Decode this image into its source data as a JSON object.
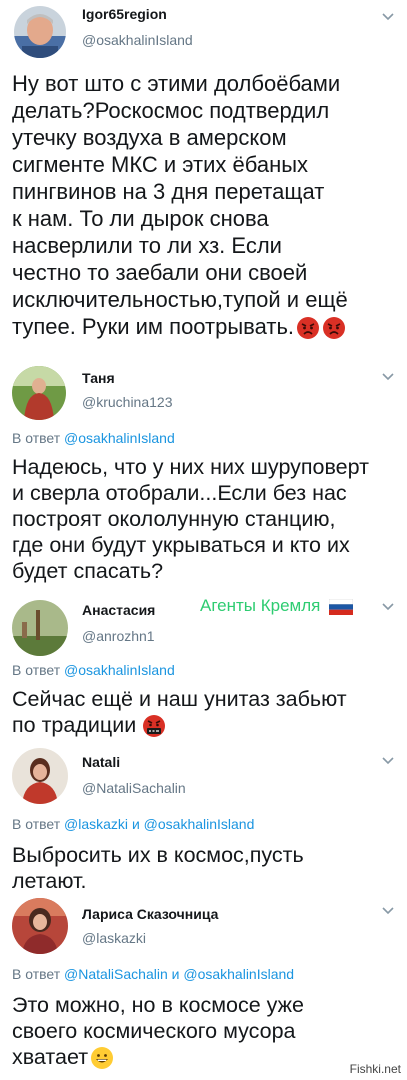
{
  "tweets": [
    {
      "name": "Igor65region",
      "handle": "@osakhalinIsland",
      "lines": [
        "Ну вот што с этими долбоёбами",
        "делать?Роскосмос подтвердил",
        "утечку воздуха в амерском",
        "сигменте МКС и этих ёбаных",
        "пингвинов на 3 дня перетащат",
        "к нам. То ли дырок снова",
        "насверлили то ли хз. Если",
        "честно то заебали они своей",
        "исключительностью,тупой и ещё",
        "тупее. Руки им поотрывать."
      ],
      "emoji": [
        "angry-face",
        "angry-face"
      ]
    },
    {
      "name": "Таня",
      "handle": "@kruchina123",
      "reply_prefix": "В ответ",
      "reply_to": "@osakhalinIsland",
      "lines": [
        "Надеюсь, что у них них шуруповерт",
        "и сверла отобрали...Если без нас",
        "построят окололунную станцию,",
        "где они будут укрываться и кто их",
        "будет спасать?"
      ]
    },
    {
      "name": "Анастасия",
      "handle": "@anrozhn1",
      "overlay": "Агенты Кремля",
      "reply_prefix": "В ответ",
      "reply_to": "@osakhalinIsland",
      "lines": [
        "Сейчас ещё и наш унитаз забьют",
        "по традиции"
      ],
      "emoji": [
        "cursing-face"
      ]
    },
    {
      "name": "Natali",
      "handle": "@NataliSachalin",
      "reply_prefix": "В ответ",
      "reply_to_1": "@laskazki",
      "reply_and": "и",
      "reply_to_2": "@osakhalinIsland",
      "lines": [
        "Выбросить их в космос,пусть",
        "летают."
      ]
    },
    {
      "name": "Лариса Сказочница",
      "handle": "@laskazki",
      "reply_prefix": "В ответ",
      "reply_to_1": "@NataliSachalin",
      "reply_and": "и",
      "reply_to_2": "@osakhalinIsland",
      "lines": [
        "Это можно, но в космосе уже",
        "своего космического мусора",
        "хватает"
      ],
      "emoji": [
        "grinning-face"
      ]
    }
  ],
  "watermark": "Fishki.net",
  "colors": {
    "link": "#1b95e0",
    "secondary": "#657786",
    "text": "#14171a",
    "overlay_green": "#2ecc71",
    "angry": "#d93025"
  }
}
